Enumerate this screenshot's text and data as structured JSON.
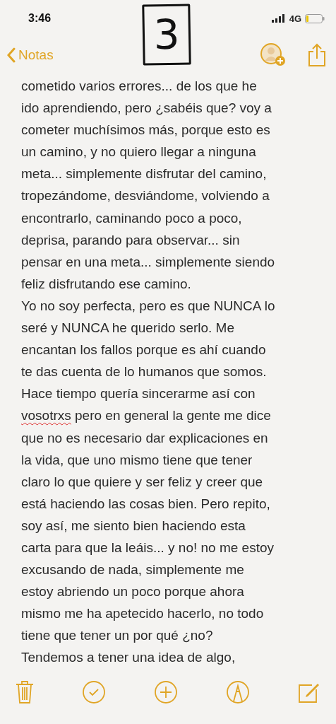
{
  "status_bar": {
    "time": "3:46",
    "network": "4G"
  },
  "sticker": {
    "number": "3"
  },
  "nav_bar": {
    "back_label": "Notas"
  },
  "note_lines": [
    {
      "text": "cometido varios errores... de los que he"
    },
    {
      "text": "ido aprendiendo, pero ¿sabéis que? voy a"
    },
    {
      "text": "cometer muchísimos más, porque esto es"
    },
    {
      "text": "un camino, y no quiero llegar a ninguna"
    },
    {
      "text": "meta... simplemente disfrutar del camino,"
    },
    {
      "text": "tropezándome, desviándome, volviendo a"
    },
    {
      "text": "encontrarlo, caminando poco a poco,"
    },
    {
      "text": "deprisa, parando para observar... sin"
    },
    {
      "text": "pensar en una meta... simplemente siendo"
    },
    {
      "text": "feliz disfrutando ese camino."
    },
    {
      "text": "Yo no soy perfecta, pero es que NUNCA lo"
    },
    {
      "text": "seré y NUNCA he querido serlo. Me"
    },
    {
      "text": "encantan los fallos porque es ahí cuando"
    },
    {
      "text": "te das cuenta de lo humanos que somos."
    },
    {
      "text": "Hace tiempo quería sincerarme así con"
    },
    {
      "misspelled": "vosotrxs",
      "text": " pero en general la gente me dice"
    },
    {
      "text": "que no es necesario dar explicaciones en"
    },
    {
      "text": "la vida, que uno mismo tiene que tener"
    },
    {
      "text": "claro lo que quiere y ser feliz y creer que"
    },
    {
      "text": "está haciendo las cosas bien. Pero repito,"
    },
    {
      "text": "soy así, me siento bien haciendo esta"
    },
    {
      "text": "carta para que la leáis... y no! no me estoy"
    },
    {
      "text": "excusando de nada, simplemente me"
    },
    {
      "text": "estoy abriendo un poco porque ahora"
    },
    {
      "text": "mismo me ha apetecido hacerlo, no todo"
    },
    {
      "text": "tiene que tener un por qué ¿no?"
    },
    {
      "text": "Tendemos a tener una idea de algo,"
    }
  ]
}
